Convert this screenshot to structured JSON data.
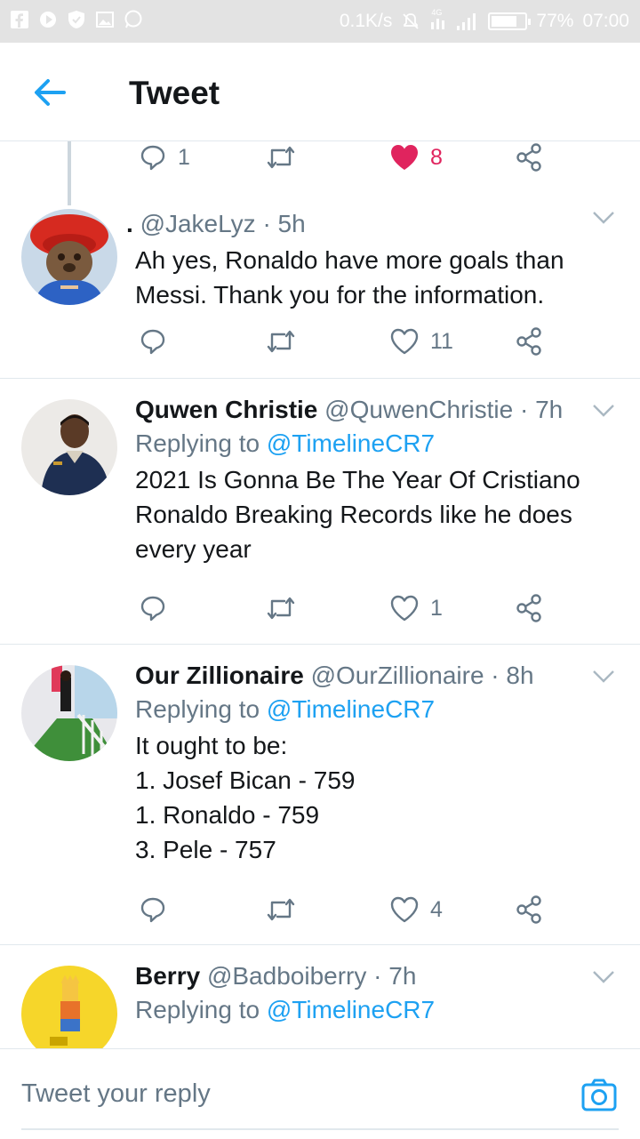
{
  "status_bar": {
    "network_speed": "0.1K/s",
    "battery": "77%",
    "battery_level": 0.77,
    "time": "07:00",
    "network_type": "4G",
    "left_icons": [
      "facebook-icon",
      "media-icon",
      "shield-icon",
      "gallery-icon",
      "whatsapp-icon"
    ]
  },
  "header": {
    "title": "Tweet",
    "back_icon": "arrow-left-icon"
  },
  "colors": {
    "accent": "#1da1f2",
    "like_active": "#e0245e",
    "muted": "#657786",
    "text": "#14171a"
  },
  "parent_tweet_actions": {
    "reply_count": "1",
    "retweet_count": "",
    "like_count": "8",
    "liked": true
  },
  "tweets": [
    {
      "name": ".",
      "handle": "@JakeLyz",
      "time": "· 5h",
      "replying_label": "",
      "replying_to": "",
      "text_lines": [
        "Ah yes, Ronaldo have more goals than",
        "Messi. Thank you for the information."
      ],
      "reply_count": "",
      "retweet_count": "",
      "like_count": "11"
    },
    {
      "name": "Quwen Christie",
      "handle": "@QuwenChristie",
      "time": "· 7h",
      "replying_label": "Replying to",
      "replying_to": "@TimelineCR7",
      "text_lines": [
        "2021 Is Gonna Be The Year Of Cristiano",
        "Ronaldo Breaking Records like he does",
        "every year"
      ],
      "reply_count": "",
      "retweet_count": "",
      "like_count": "1"
    },
    {
      "name": "Our Zillionaire",
      "handle": "@OurZillionaire",
      "time": "· 8h",
      "replying_label": "Replying to",
      "replying_to": "@TimelineCR7",
      "text_lines": [
        "It ought to be:",
        "1. Josef Bican - 759",
        "1. Ronaldo - 759",
        "3. Pele - 757"
      ],
      "reply_count": "",
      "retweet_count": "",
      "like_count": "4"
    },
    {
      "name": "Berry",
      "handle": "@Badboiberry",
      "time": "· 7h",
      "replying_label": "Replying to",
      "replying_to": "@TimelineCR7",
      "text_lines": [],
      "reply_count": "",
      "retweet_count": "",
      "like_count": ""
    }
  ],
  "reply_bar": {
    "placeholder": "Tweet your reply",
    "camera_icon": "camera-icon"
  }
}
